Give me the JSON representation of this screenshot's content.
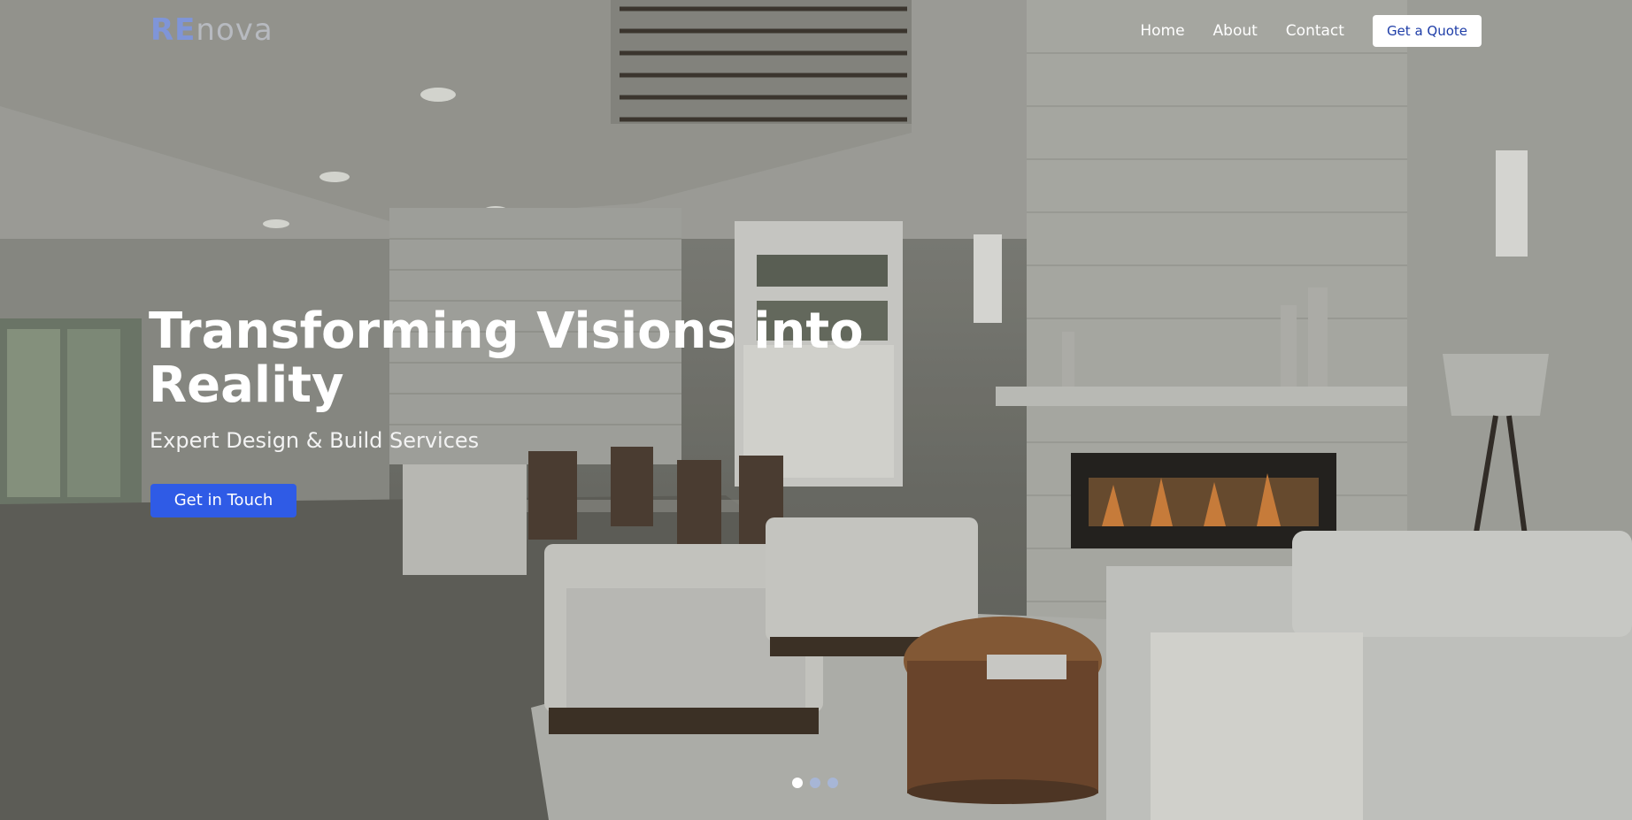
{
  "brand": {
    "logo_prefix": "RE",
    "logo_suffix": "nova"
  },
  "nav": {
    "items": [
      {
        "label": "Home"
      },
      {
        "label": "About"
      },
      {
        "label": "Contact"
      }
    ],
    "quote_button": "Get a Quote"
  },
  "hero": {
    "headline": "Transforming Visions into Reality",
    "subheadline": "Expert Design & Build Services",
    "cta_label": "Get in Touch",
    "background_image": "modern living room interior with fireplace, armchairs and dining area",
    "slides": {
      "count": 3,
      "active_index": 0
    }
  },
  "colors": {
    "accent": "#2f5be6",
    "logo_accent": "#7f95d8",
    "quote_text": "#1f3ea8"
  }
}
